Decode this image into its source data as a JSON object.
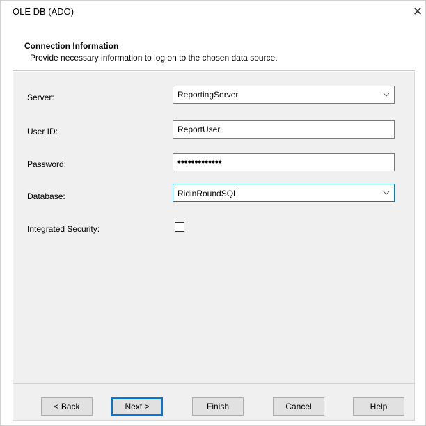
{
  "window": {
    "title": "OLE DB (ADO)",
    "close_glyph": "✕"
  },
  "header": {
    "title": "Connection Information",
    "subtitle": "Provide necessary information to log on to the chosen data source."
  },
  "form": {
    "server": {
      "label": "Server:",
      "value": "ReportingServer"
    },
    "user_id": {
      "label": "User ID:",
      "value": "ReportUser"
    },
    "password": {
      "label": "Password:",
      "value": "•••••••••••••"
    },
    "database": {
      "label": "Database:",
      "value": "RidinRoundSQL"
    },
    "integrated_security": {
      "label": "Integrated Security:",
      "checked": false
    }
  },
  "buttons": {
    "back": "< Back",
    "next": "Next >",
    "finish": "Finish",
    "cancel": "Cancel",
    "help": "Help"
  },
  "colors": {
    "focus_accent": "#0078d7",
    "panel_bg": "#f0f0f0"
  },
  "icons": {
    "combo_arrow": "chevron-down-icon",
    "close": "close-icon"
  }
}
